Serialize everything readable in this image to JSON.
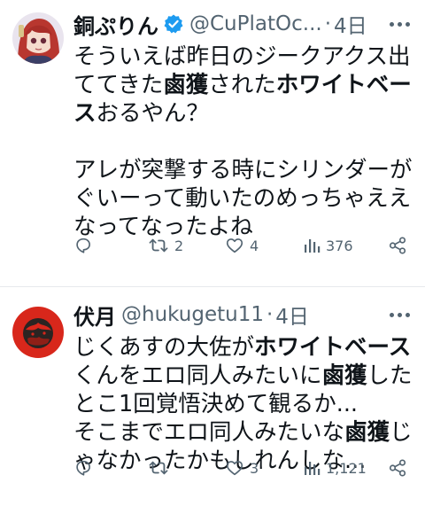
{
  "tweets": [
    {
      "author_name": "銅ぷりん",
      "handle": "@CuPlatOc...",
      "separator": "·",
      "time": "4日",
      "verified": true,
      "lines": [
        [
          {
            "t": "そういえば昨日のジークアクス出"
          }
        ],
        [
          {
            "t": "ててきた"
          },
          {
            "t": "鹵獲",
            "b": true
          },
          {
            "t": "された"
          },
          {
            "t": "ホワイトベー",
            "b": true
          }
        ],
        [
          {
            "t": "ス",
            "b": true
          },
          {
            "t": "おるやん？"
          }
        ],
        [],
        [
          {
            "t": "アレが突撃する時にシリンダーが"
          }
        ],
        [
          {
            "t": "ぐいーって動いたのめっちゃええ"
          }
        ],
        [
          {
            "t": "なってなったよね"
          }
        ]
      ],
      "stats": {
        "replies": "",
        "retweets": "2",
        "likes": "4",
        "views": "376"
      }
    },
    {
      "author_name": "伏月",
      "handle": "@hukugetu11",
      "separator": "·",
      "time": "4日",
      "verified": false,
      "lines": [
        [
          {
            "t": "じくあすの大佐が"
          },
          {
            "t": "ホワイトベース",
            "b": true
          }
        ],
        [
          {
            "t": "くんをエロ同人みたいに"
          },
          {
            "t": "鹵獲",
            "b": true
          },
          {
            "t": "した"
          }
        ],
        [
          {
            "t": "とこ1回覚悟決めて観るか..."
          }
        ],
        [
          {
            "t": "そこまでエロ同人みたいな"
          },
          {
            "t": "鹵獲",
            "b": true
          },
          {
            "t": "じ"
          }
        ],
        [
          {
            "t": "ゃなかったかもしれんしな..."
          }
        ]
      ],
      "stats": {
        "replies": "",
        "retweets": "",
        "likes": "3",
        "views": "1,121"
      }
    }
  ],
  "colors": {
    "text": "#0f1419",
    "muted": "#536471",
    "verified": "#1d9bf0",
    "divider": "#e6e9ec"
  },
  "icons": [
    "reply-icon",
    "retweet-icon",
    "like-icon",
    "views-icon",
    "share-icon",
    "more-icon",
    "verified-icon"
  ]
}
